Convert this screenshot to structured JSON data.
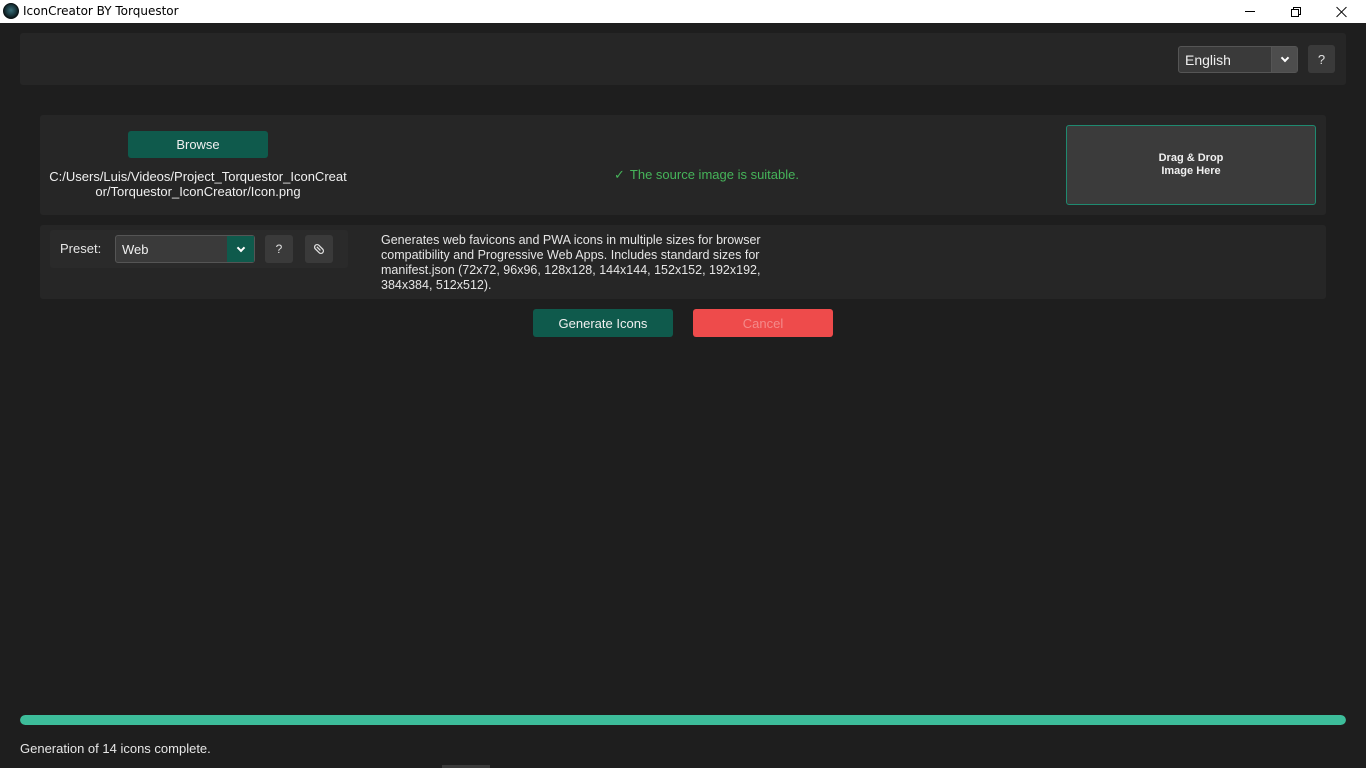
{
  "window": {
    "title": "IconCreator BY Torquestor",
    "controls": [
      "minimize-icon",
      "restore-icon",
      "close-icon"
    ]
  },
  "toolbar": {
    "language": "English",
    "help_label": "?"
  },
  "source": {
    "browse_label": "Browse",
    "path": "C:/Users/Luis/Videos/Project_Torquestor_IconCreator/Torquestor_IconCreator/Icon.png",
    "status_check": "✓",
    "status_text": "The source image is suitable.",
    "drop_zone": "Drag & Drop\nImage Here"
  },
  "preset": {
    "label": "Preset:",
    "value": "Web",
    "help_label": "?",
    "clip_icon": "paperclip-icon",
    "description": "Generates web favicons and PWA icons in multiple sizes for browser compatibility and Progressive Web Apps. Includes standard sizes for manifest.json (72x72, 96x96, 128x128, 144x144, 152x152, 192x192, 384x384, 512x512)."
  },
  "actions": {
    "generate_label": "Generate Icons",
    "cancel_label": "Cancel"
  },
  "progress": {
    "value_percent": 100,
    "status": "Generation of 14 icons complete."
  },
  "colors": {
    "accent": "#0f5a4c",
    "progress": "#3dbd9a",
    "cancel": "#ee4b4b",
    "success": "#46b45a"
  }
}
